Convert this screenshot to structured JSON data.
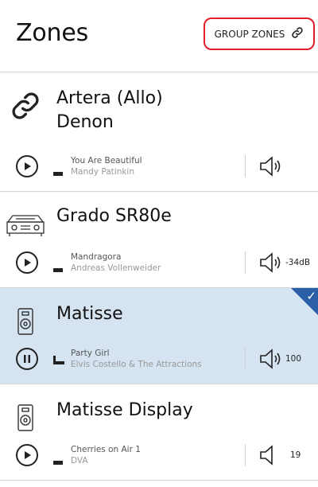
{
  "header": {
    "title": "Zones",
    "group_button_label": "GROUP ZONES"
  },
  "colors": {
    "accent_outline": "#e31d2b",
    "selected_background": "#d6e3f1",
    "check_corner": "#2a5fa8"
  },
  "zones": [
    {
      "name_line1": "Artera (Allo)",
      "name_line2": "Denon",
      "icon": "link-icon",
      "playback": "stopped",
      "track_title": "You Are Beautiful",
      "track_artist": "Mandy Patinkin",
      "volume_label": "",
      "volume_icon": "speaker-high-icon"
    },
    {
      "name_line1": "Grado SR80e",
      "icon": "amplifier-icon",
      "playback": "stopped",
      "track_title": "Mandragora",
      "track_artist": "Andreas Vollenweider",
      "volume_label": "-34dB",
      "volume_icon": "speaker-high-icon"
    },
    {
      "name_line1": "Matisse",
      "icon": "speaker-device-icon",
      "playback": "playing",
      "selected": true,
      "track_title": "Party Girl",
      "track_artist": "Elvis Costello & The Attractions",
      "volume_label": "100",
      "volume_icon": "speaker-high-icon"
    },
    {
      "name_line1": "Matisse Display",
      "icon": "speaker-device-icon",
      "playback": "stopped",
      "track_title": "Cherries on Air 1",
      "track_artist": "DVA",
      "volume_label": "19",
      "volume_icon": "speaker-low-icon"
    }
  ]
}
